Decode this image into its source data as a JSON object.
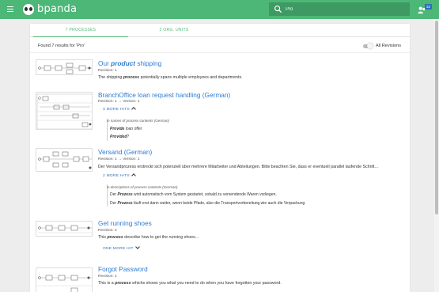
{
  "app": {
    "brand": "bpanda",
    "search_value": "Pro",
    "notification_count": "32"
  },
  "tabs": [
    {
      "label": "7 PROCESSES",
      "active": true
    },
    {
      "label": "2 ORG. UNITS",
      "active": false
    }
  ],
  "summary": {
    "found_text": "Found 7 results for 'Pro'",
    "revisions_label": "All Revisions"
  },
  "results": [
    {
      "title_pre": "Our ",
      "title_bold": "product",
      "title_post": " shipping",
      "revision": "Revision: 1",
      "desc_pre": "The shipping ",
      "desc_bold": "process",
      "desc_post": " potentially spans multiple employees and departments."
    },
    {
      "title": "BranchOffice loan request handling  (German)",
      "revision": "Revision: 1 → Version: 1",
      "more_label": "3 MORE HITS",
      "hits_header": "in names of process contents (German)",
      "hits": [
        {
          "bold": "Provide",
          "text": " loan offer"
        },
        {
          "bold": "Provided",
          "text": "?"
        }
      ]
    },
    {
      "title": "Versand  (German)",
      "revision": "Revision: 1 → Version: 1",
      "desc": "Der Versandprozess erstreckt sich potenziell über mehrere Mitarbeiter und Abteilungen. Bitte beachten Sie, dass er eventuell parallel laufende Schritt…",
      "more_label": "2 MORE HITS",
      "hits_header": "in descriptions of process contents (German)",
      "hits": [
        {
          "pre": "Der ",
          "bold": "Prozess",
          "text": " wird automatisch vom System gestartet, sobald zu versendende Waren vorliegen."
        },
        {
          "pre": "Der ",
          "bold": "Prozess",
          "text": " läuft erst dann weiter, wenn beide Pfade, also die Transportvorbereitung wie auch die Verpackung"
        }
      ]
    },
    {
      "title": "Get running shoes",
      "revision": "Revision: 2",
      "desc_pre": "This ",
      "desc_bold": "process",
      "desc_post": " describe how to get the running shoes...",
      "more_label": "ONE MORE HIT"
    },
    {
      "title": "Forgot Password",
      "revision": "Revision: 1",
      "desc_pre": "This is a ",
      "desc_bold": "process",
      "desc_post": " whichs shows you what you need to do when you have forgotten your password."
    }
  ]
}
